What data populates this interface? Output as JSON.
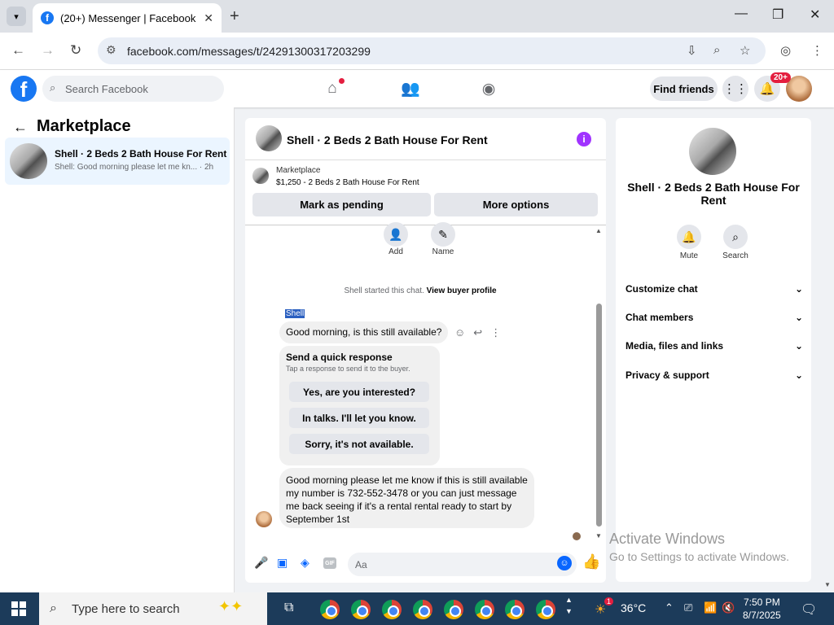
{
  "browser": {
    "tab_title": "(20+) Messenger | Facebook",
    "url": "facebook.com/messages/t/24291300317203299"
  },
  "fb": {
    "search_placeholder": "Search Facebook",
    "find_friends": "Find friends",
    "notification_badge": "20+"
  },
  "left": {
    "title": "Marketplace",
    "conversation": {
      "title": "Shell · 2 Beds 2 Bath House For Rent",
      "snippet": "Shell: Good morning please let me kn...",
      "time": "· 2h"
    }
  },
  "chat": {
    "header_title": "Shell · 2 Beds 2 Bath House For Rent",
    "marketplace_label": "Marketplace",
    "listing_price": "$1,250 - 2 Beds 2 Bath House For Rent",
    "mark_pending": "Mark as pending",
    "more_options": "More options",
    "add_label": "Add",
    "name_label": "Name",
    "started_text": "Shell started this chat.",
    "view_buyer": "View buyer profile",
    "sender_name": "Shell",
    "msg1": "Good morning, is this still available?",
    "quick_title": "Send a quick response",
    "quick_sub": "Tap a response to send it to the buyer.",
    "quick_replies": [
      "Yes, are you interested?",
      "In talks. I'll let you know.",
      "Sorry, it's not available."
    ],
    "msg2": "Good morning please let me know if this is still available my number is 732-552-3478 or you can just message me back seeing if it's a rental rental ready to start by September 1st",
    "composer_placeholder": "Aa",
    "gif_label": "GIF"
  },
  "right": {
    "title": "Shell · 2 Beds 2 Bath House For Rent",
    "mute": "Mute",
    "search": "Search",
    "sections": [
      "Customize chat",
      "Chat members",
      "Media, files and links",
      "Privacy & support"
    ]
  },
  "overlay": {
    "activate_title": "Activate Windows",
    "activate_sub": "Go to Settings to activate Windows."
  },
  "taskbar": {
    "search_placeholder": "Type here to search",
    "weather_badge": "1",
    "temperature": "36°C",
    "time": "7:50 PM",
    "date": "8/7/2025"
  }
}
